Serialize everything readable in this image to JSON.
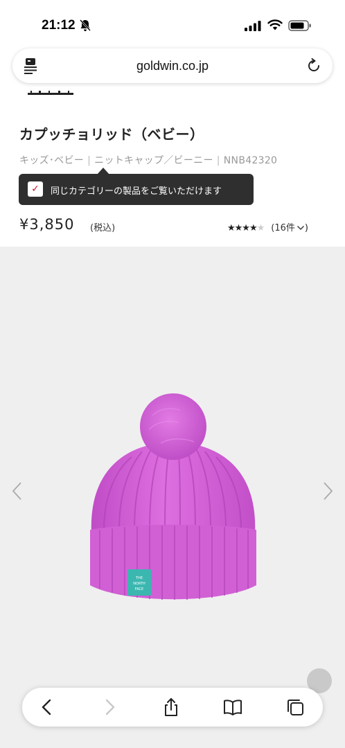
{
  "status_bar": {
    "time": "21:12",
    "icons": [
      "bell-slash-icon",
      "cellular-signal-icon",
      "wifi-icon",
      "battery-icon"
    ]
  },
  "browser": {
    "url": "goldwin.co.jp",
    "left_icon": "reader-icon",
    "right_icon": "reload-icon"
  },
  "product": {
    "title": "カプッチョリッド（ベビー）",
    "breadcrumb": [
      "キッズ･ベビー",
      "ニットキャップ／ビーニー",
      "NNB42320"
    ],
    "price": "¥3,850",
    "tax_label": "(税込)",
    "rating": {
      "value": 4,
      "max": 5
    },
    "review_count": "(16件",
    "review_icon": "chevron-down-icon"
  },
  "tooltip": {
    "checked": true,
    "text": "同じカテゴリーの製品をご覧いただけます"
  },
  "gallery": {
    "prev_icon": "chevron-left-icon",
    "next_icon": "chevron-right-icon",
    "image": "pink-knit-beanie-with-pom-pom",
    "badge_text": "THE NORTH FACE",
    "colors": {
      "beanie": "#d463d8",
      "badge": "#3bb7b0",
      "background": "#efefef"
    }
  },
  "toolbar": {
    "buttons": [
      "back-icon",
      "forward-icon",
      "share-icon",
      "bookmarks-icon",
      "tabs-icon"
    ]
  }
}
